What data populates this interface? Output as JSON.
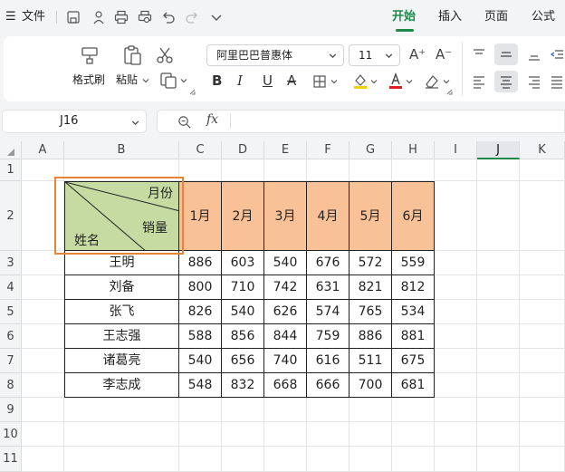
{
  "menu": {
    "app_menu_label": "文件",
    "tabs": [
      "开始",
      "插入",
      "页面",
      "公式"
    ],
    "active_tab": "开始"
  },
  "ribbon": {
    "format_painter_label": "格式刷",
    "paste_label": "粘贴",
    "font_name": "阿里巴巴普惠体",
    "font_size": "11",
    "highlight_color": "#f5d000",
    "font_color": "#e02020"
  },
  "formula_bar": {
    "name_box": "J16",
    "fx_label": "fx",
    "content": ""
  },
  "sheet": {
    "columns": [
      "A",
      "B",
      "C",
      "D",
      "E",
      "F",
      "G",
      "H",
      "I",
      "J",
      "K"
    ],
    "active_column": "J",
    "rows": [
      "1",
      "2",
      "3",
      "4",
      "5",
      "6",
      "7",
      "8",
      "9",
      "10",
      "11"
    ],
    "header_cell": {
      "month_label": "月份",
      "sales_label": "销量",
      "name_label": "姓名",
      "fill": "#c6dba2"
    },
    "months": [
      "1月",
      "2月",
      "3月",
      "4月",
      "5月",
      "6月"
    ],
    "month_fill": "#f9c197",
    "people": [
      {
        "name": "王明",
        "values": [
          "886",
          "603",
          "540",
          "676",
          "572",
          "559"
        ]
      },
      {
        "name": "刘备",
        "values": [
          "800",
          "710",
          "742",
          "631",
          "821",
          "812"
        ]
      },
      {
        "name": "张飞",
        "values": [
          "826",
          "540",
          "626",
          "574",
          "765",
          "534"
        ]
      },
      {
        "name": "王志强",
        "values": [
          "588",
          "856",
          "844",
          "759",
          "886",
          "881"
        ]
      },
      {
        "name": "诸葛亮",
        "values": [
          "540",
          "656",
          "740",
          "616",
          "511",
          "675"
        ]
      },
      {
        "name": "李志成",
        "values": [
          "548",
          "832",
          "668",
          "666",
          "700",
          "681"
        ]
      }
    ],
    "selection_color": "#e8843a",
    "accent": "#1e8a4a"
  }
}
